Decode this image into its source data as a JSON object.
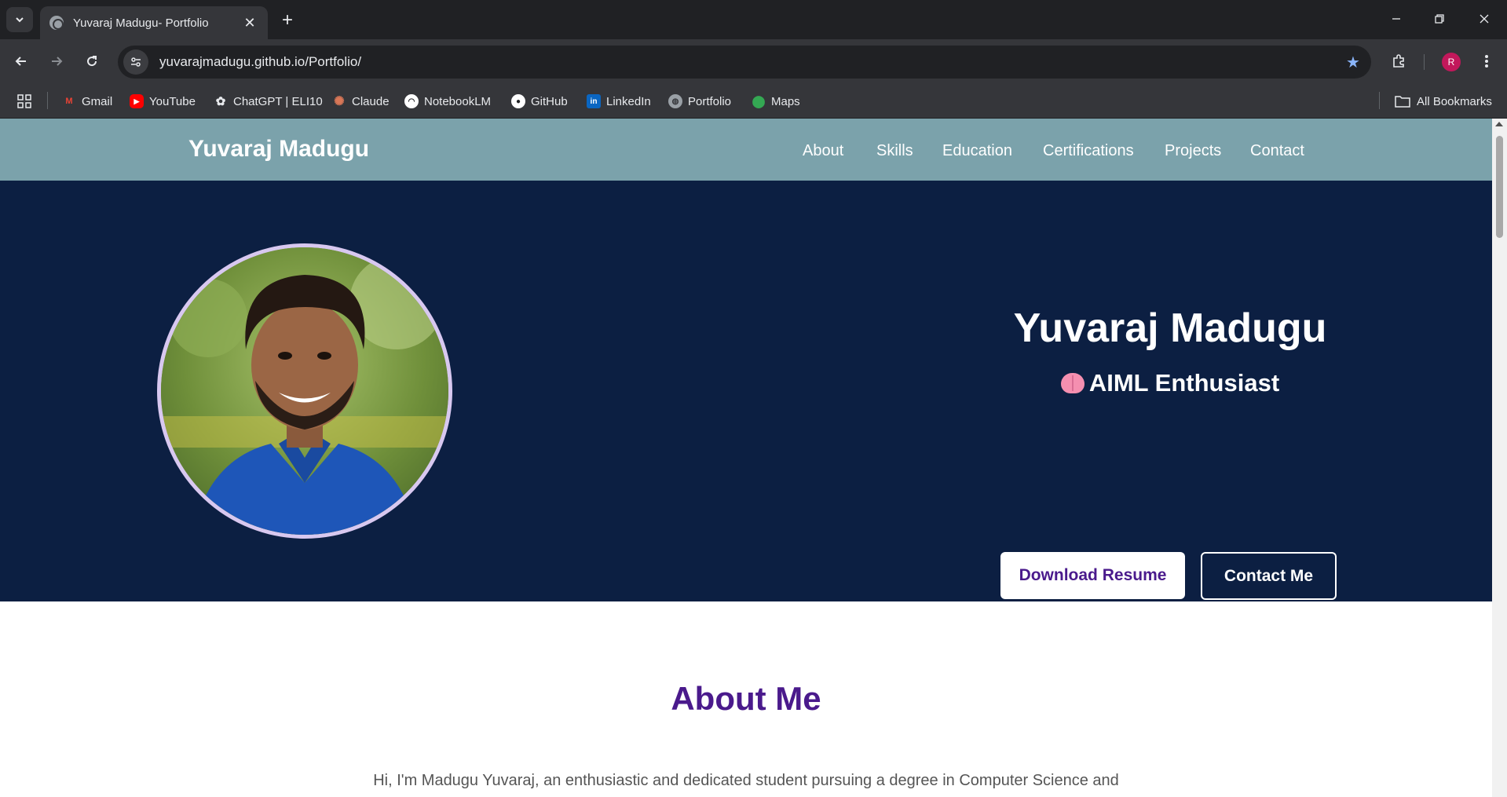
{
  "browser": {
    "tab_title": "Yuvaraj Madugu- Portfolio",
    "url_host": "yuvarajmadugu.github.io",
    "url_path": "/Portfolio/",
    "profile_initial": "R",
    "bookmarks": [
      {
        "label": "Gmail",
        "icon": "gmail-icon",
        "color": "#ea4335"
      },
      {
        "label": "YouTube",
        "icon": "youtube-icon",
        "color": "#ff0000"
      },
      {
        "label": "ChatGPT | ELI10",
        "icon": "chatgpt-icon",
        "color": "#e8eaed"
      },
      {
        "label": "Claude",
        "icon": "claude-icon",
        "color": "#d97757"
      },
      {
        "label": "NotebookLM",
        "icon": "notebooklm-icon",
        "color": "#ffffff"
      },
      {
        "label": "GitHub",
        "icon": "github-icon",
        "color": "#ffffff"
      },
      {
        "label": "LinkedIn",
        "icon": "linkedin-icon",
        "color": "#0a66c2"
      },
      {
        "label": "Portfolio",
        "icon": "globe-icon",
        "color": "#9aa0a6"
      },
      {
        "label": "Maps",
        "icon": "maps-icon",
        "color": "#34a853"
      }
    ],
    "all_bookmarks_label": "All Bookmarks"
  },
  "site": {
    "brand": "Yuvaraj Madugu",
    "nav": [
      "About",
      "Skills",
      "Education",
      "Certifications",
      "Projects",
      "Contact"
    ],
    "nav_color": "#7ba2ab"
  },
  "hero": {
    "name": "Yuvaraj Madugu",
    "role": "AIML Enthusiast",
    "primary_button": "Download Resume",
    "secondary_button": "Contact Me",
    "background": "#0c1f42"
  },
  "about": {
    "title": "About Me",
    "text": "Hi, I'm Madugu Yuvaraj, an enthusiastic and dedicated student pursuing a degree in Computer Science and"
  }
}
